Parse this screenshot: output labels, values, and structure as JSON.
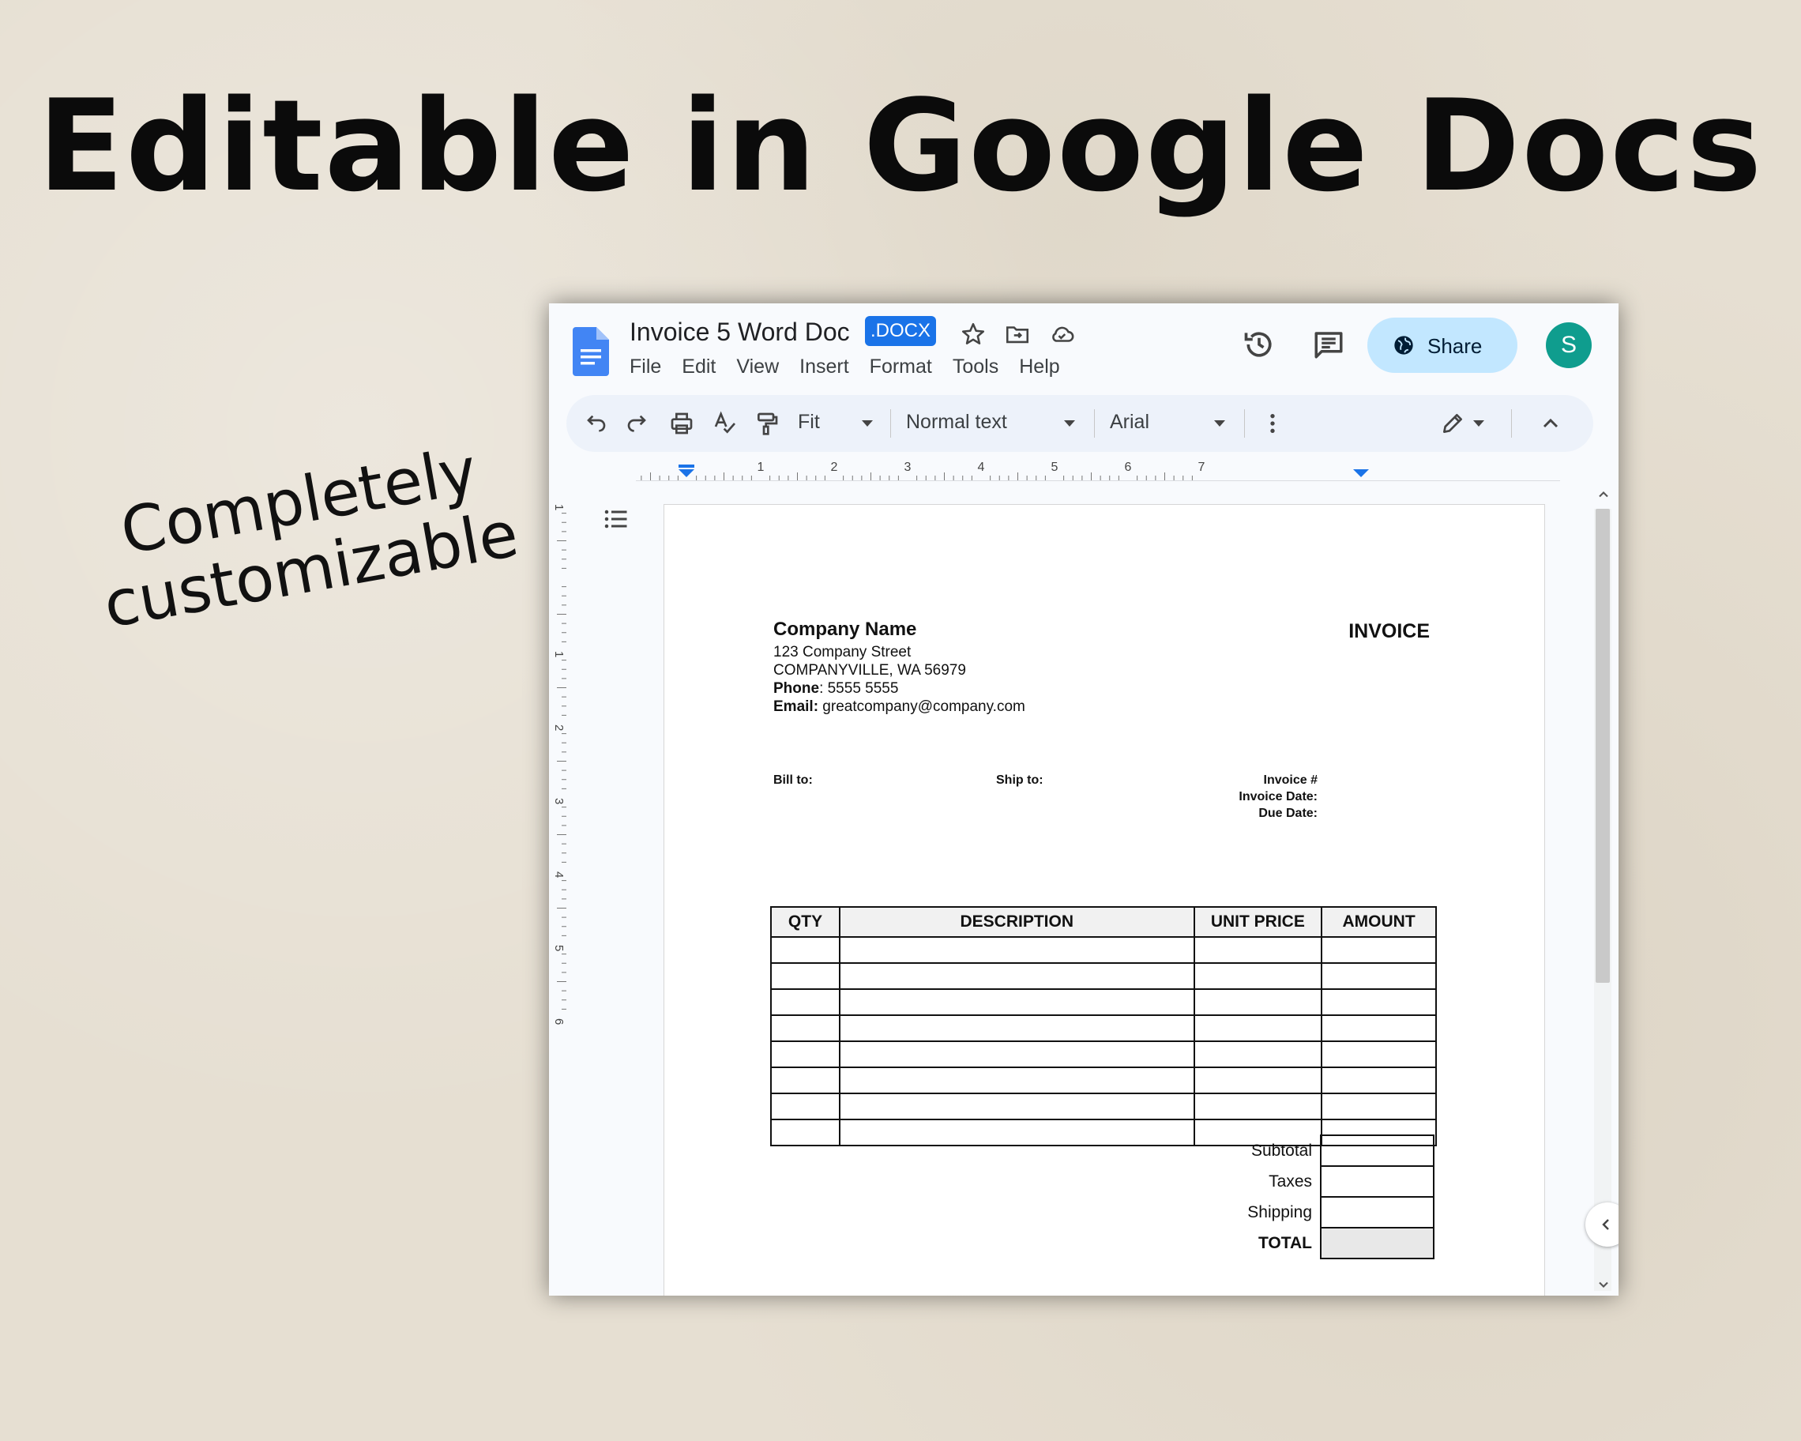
{
  "headline": "Editable in Google Docs",
  "side_note": {
    "line1": "Completely",
    "line2": "customizable"
  },
  "window": {
    "doc_title": "Invoice 5 Word Doc",
    "badge": ".DOCX",
    "menu": [
      "File",
      "Edit",
      "View",
      "Insert",
      "Format",
      "Tools",
      "Help"
    ],
    "share_label": "Share",
    "avatar_letter": "S",
    "icons": [
      "docs-logo-icon",
      "star-icon",
      "move-folder-icon",
      "cloud-status-icon",
      "history-icon",
      "comment-icon",
      "globe-icon"
    ]
  },
  "toolbar": {
    "zoom": "Fit",
    "style": "Normal text",
    "font": "Arial",
    "icons": [
      "undo-icon",
      "redo-icon",
      "print-icon",
      "spellcheck-icon",
      "paint-format-icon",
      "more-vert-icon",
      "edit-mode-icon",
      "collapse-toolbar-icon"
    ]
  },
  "ruler": {
    "marks": [
      "1",
      "1",
      "2",
      "3",
      "4",
      "5",
      "6",
      "7"
    ],
    "vmarks": [
      "1",
      "1",
      "2",
      "3",
      "4",
      "5",
      "6"
    ]
  },
  "invoice": {
    "company_name": "Company Name",
    "street": "123 Company Street",
    "city": "COMPANYVILLE, WA 56979",
    "phone_label": "Phone",
    "phone_value": ": 5555 5555",
    "email_label": "Email:",
    "email_value": " greatcompany@company.com",
    "title": "INVOICE",
    "bill_to": "Bill to:",
    "ship_to": "Ship to:",
    "invoice_no": "Invoice #",
    "invoice_date": "Invoice Date:",
    "due_date": "Due Date:",
    "columns": [
      "QTY",
      "DESCRIPTION",
      "UNIT PRICE",
      "AMOUNT"
    ],
    "empty_rows": 8,
    "totals": [
      "Subtotal",
      "Taxes",
      "Shipping",
      "TOTAL"
    ]
  },
  "colors": {
    "accent": "#1a73e8",
    "share_bg": "#c2e7ff",
    "avatar": "#0f9d8e",
    "background": "#e6dfd2"
  }
}
